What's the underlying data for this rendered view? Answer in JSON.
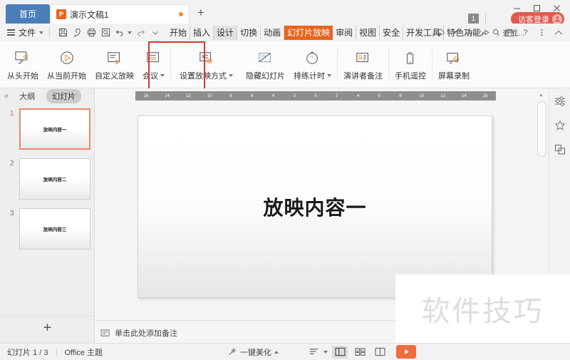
{
  "window": {
    "home_tab": "首页",
    "doc_tab": "演示文稿1",
    "doc_icon_letter": "P",
    "add_tab": "+",
    "notification_count": "1",
    "guest_login": "访客登录"
  },
  "menu": {
    "file_label": "文件",
    "quick_access": [
      "save-icon",
      "share-pen-icon",
      "print-icon",
      "print-preview-icon",
      "undo-icon",
      "redo-icon",
      "more-icon"
    ],
    "ribbon_tabs": [
      {
        "label": "开始",
        "state": "normal"
      },
      {
        "label": "插入",
        "state": "normal"
      },
      {
        "label": "设计",
        "state": "hover"
      },
      {
        "label": "切换",
        "state": "normal"
      },
      {
        "label": "动画",
        "state": "normal"
      },
      {
        "label": "幻灯片放映",
        "state": "active"
      },
      {
        "label": "审阅",
        "state": "normal"
      },
      {
        "label": "视图",
        "state": "normal"
      },
      {
        "label": "安全",
        "state": "normal"
      },
      {
        "label": "开发工具",
        "state": "normal"
      },
      {
        "label": "特色功能",
        "state": "normal"
      }
    ],
    "find_label": "查找...",
    "right_icons": [
      "cloud-sync-icon",
      "add-user-icon",
      "share-icon",
      "window-snap-icon",
      "help-icon",
      "more-vertical-icon",
      "collapse-ribbon-icon"
    ]
  },
  "ribbon": {
    "items": [
      {
        "label": "从头开始",
        "icon": "present-from-start-icon",
        "dropdown": false
      },
      {
        "label": "从当前开始",
        "icon": "present-from-current-icon",
        "dropdown": false
      },
      {
        "label": "自定义放映",
        "icon": "custom-show-icon",
        "dropdown": false
      },
      {
        "label": "会议",
        "icon": "meeting-icon",
        "dropdown": true
      },
      {
        "label": "设置放映方式",
        "icon": "setup-show-icon",
        "dropdown": true
      },
      {
        "label": "隐藏幻灯片",
        "icon": "hide-slide-icon",
        "dropdown": false
      },
      {
        "label": "排练计时",
        "icon": "rehearse-timing-icon",
        "dropdown": true
      },
      {
        "label": "演讲者备注",
        "icon": "presenter-notes-icon",
        "dropdown": false
      },
      {
        "label": "手机遥控",
        "icon": "phone-remote-icon",
        "dropdown": false
      },
      {
        "label": "屏幕录制",
        "icon": "screen-record-icon",
        "dropdown": false
      }
    ],
    "highlight_color": "#e03131",
    "highlighted_item": "设置放映方式"
  },
  "sidebar": {
    "collapse_label": "«",
    "tabs": [
      {
        "label": "大纲",
        "active": false
      },
      {
        "label": "幻灯片",
        "active": true
      }
    ],
    "thumbnails": [
      {
        "number": "1",
        "text": "放映内容一",
        "selected": true
      },
      {
        "number": "2",
        "text": "放映内容二",
        "selected": false
      },
      {
        "number": "3",
        "text": "放映内容三",
        "selected": false
      }
    ],
    "add_slide_label": "+"
  },
  "ruler": {
    "ticks": [
      "16",
      "14",
      "12",
      "10",
      "8",
      "6",
      "4",
      "2",
      "0",
      "2",
      "4",
      "6",
      "8",
      "10",
      "12",
      "14",
      "16"
    ]
  },
  "canvas": {
    "slide_title": "放映内容一",
    "notes_placeholder": "单击此处添加备注"
  },
  "right_rail": {
    "icons": [
      "properties-panel-icon",
      "shapes-panel-icon",
      "layers-panel-icon"
    ]
  },
  "watermark": {
    "text": "软件技巧"
  },
  "statusbar": {
    "slide_counter": "幻灯片 1 / 3",
    "theme": "Office 主题",
    "beautify": "一键美化",
    "view_buttons": [
      "outline-view-icon",
      "normal-view-icon",
      "slide-sorter-icon",
      "reading-view-icon"
    ],
    "play_button": "play-icon"
  },
  "colors": {
    "accent_orange": "#e8641e",
    "play_orange": "#ef6c3e",
    "home_blue": "#4a7ebb",
    "login_red": "#e05a4f",
    "highlight_red": "#e03131"
  }
}
